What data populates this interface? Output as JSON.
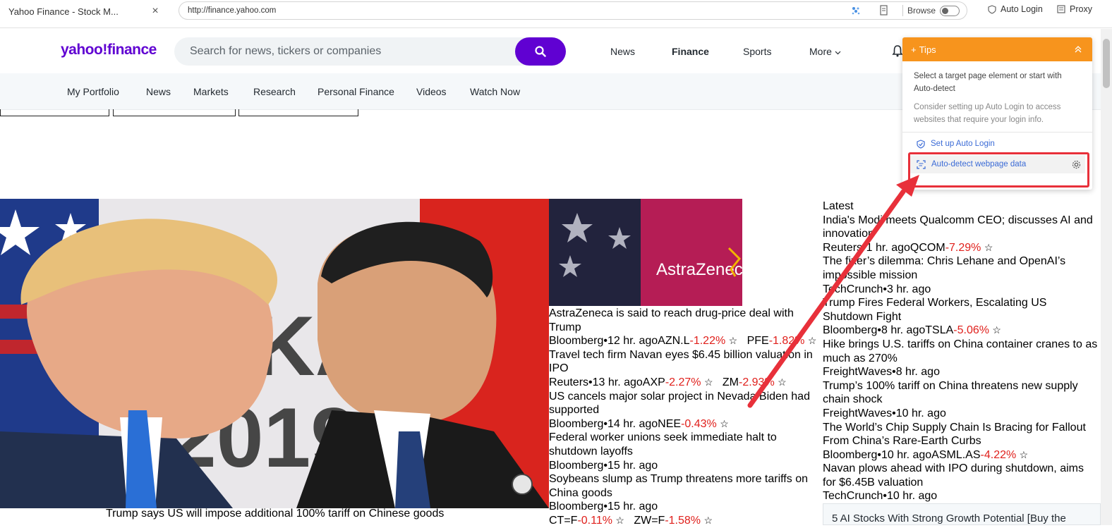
{
  "browser": {
    "tab_title": "Yahoo Finance - Stock M...",
    "tab_close": "×",
    "url": "http://finance.yahoo.com",
    "browse_label": "Browse",
    "auto_login": "Auto Login",
    "proxy": "Proxy"
  },
  "header": {
    "logo": "yahoo!finance",
    "search_placeholder": "Search for news, tickers or companies",
    "nav": [
      "News",
      "Finance",
      "Sports",
      "More"
    ]
  },
  "subnav": [
    "My Portfolio",
    "News",
    "Markets",
    "Research",
    "Personal Finance",
    "Videos",
    "Watch Now"
  ],
  "hero": {
    "caption": "Trump says US will impose additional 100% tariff on Chinese goods"
  },
  "thumb": {
    "label": "AstraZeneca"
  },
  "middle_column": [
    {
      "headline": "AstraZeneca is said to reach drug-price deal with Trump",
      "source": "Bloomberg•12 hr. ago",
      "tickers": [
        {
          "sym": "AZN.L",
          "chg": "-1.22%"
        },
        {
          "sym": "PFE",
          "chg": "-1.82%"
        }
      ]
    },
    {
      "headline": "Travel tech firm Navan eyes $6.45 billion valuation in IPO",
      "source": "Reuters•13 hr. ago",
      "tickers": [
        {
          "sym": "AXP",
          "chg": "-2.27%"
        },
        {
          "sym": "ZM",
          "chg": "-2.93%"
        }
      ]
    },
    {
      "headline": "US cancels major solar project in Nevada Biden had supported",
      "source": "Bloomberg•14 hr. ago",
      "tickers": [
        {
          "sym": "NEE",
          "chg": "-0.43%"
        }
      ]
    },
    {
      "headline": "Federal worker unions seek immediate halt to shutdown layoffs",
      "source": "Bloomberg•15 hr. ago",
      "tickers": []
    },
    {
      "headline": "Soybeans slump as Trump threatens more tariffs on China goods",
      "source": "Bloomberg•15 hr. ago",
      "tickers": [
        {
          "sym": "CT=F",
          "chg": "-0.11%"
        },
        {
          "sym": "ZW=F",
          "chg": "-1.58%"
        }
      ]
    }
  ],
  "latest": {
    "title": "Latest",
    "items": [
      {
        "headline": "India's Modi meets Qualcomm CEO; discusses AI and innovation",
        "source": "Reuters•1 hr. ago",
        "tickers": [
          {
            "sym": "QCOM",
            "chg": "-7.29%"
          }
        ]
      },
      {
        "headline": "The fixer’s dilemma: Chris Lehane and OpenAI’s impossible mission",
        "source": "TechCrunch•3 hr. ago",
        "tickers": []
      },
      {
        "headline": "Trump Fires Federal Workers, Escalating US Shutdown Fight",
        "source": "Bloomberg•8 hr. ago",
        "tickers": [
          {
            "sym": "TSLA",
            "chg": "-5.06%"
          }
        ]
      },
      {
        "headline": "Hike brings U.S. tariffs on China container cranes to as much as 270%",
        "source": "FreightWaves•8 hr. ago",
        "tickers": []
      },
      {
        "headline": "Trump’s 100% tariff on China threatens new supply chain shock",
        "source": "FreightWaves•10 hr. ago",
        "tickers": []
      },
      {
        "headline": "The World’s Chip Supply Chain Is Bracing for Fallout From China’s Rare-Earth Curbs",
        "source": "Bloomberg•10 hr. ago",
        "tickers": [
          {
            "sym": "ASML.AS",
            "chg": "-4.22%"
          }
        ]
      },
      {
        "headline": "Navan plows ahead with IPO during shutdown, aims for $6.45B valuation",
        "source": "TechCrunch•10 hr. ago",
        "tickers": []
      }
    ],
    "bottom_card": "5 AI Stocks With Strong Growth Potential [Buy the"
  },
  "tips": {
    "title": "Tips",
    "line1": "Select a target page element or start with Auto-detect",
    "line2": "Consider setting up Auto Login to access websites that require your login info.",
    "link1": "Set up Auto Login",
    "link2": "Auto-detect webpage data"
  },
  "colors": {
    "brand": "#6001d2",
    "negative": "#e0201c",
    "tips": "#f7941d",
    "annotation": "#e8303a"
  }
}
